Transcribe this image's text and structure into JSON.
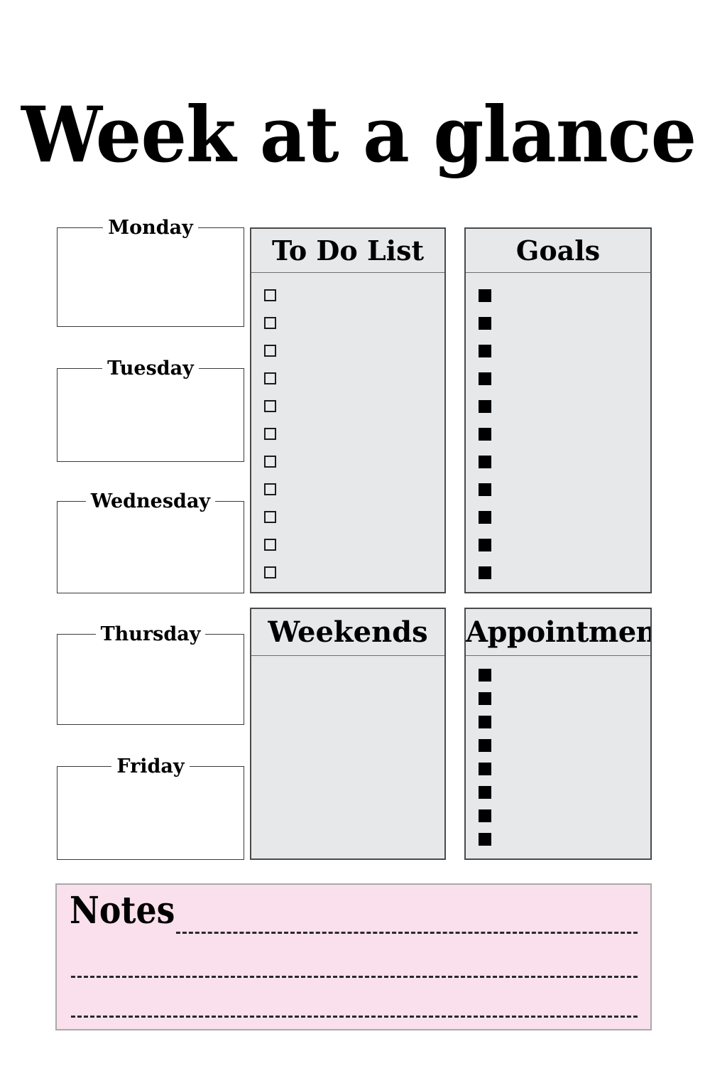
{
  "page": {
    "title": "Week at a glance",
    "background_color": "#ffffff",
    "panel_fill": "#e6e8ea",
    "panel_border": "#4a4a4a",
    "notes_fill": "#fae0ec",
    "notes_border": "#a9a9a9",
    "text_color": "#000000"
  },
  "days": [
    {
      "label": "Monday"
    },
    {
      "label": "Tuesday"
    },
    {
      "label": "Wednesday"
    },
    {
      "label": "Thursday"
    },
    {
      "label": "Friday"
    }
  ],
  "panels": {
    "todo": {
      "title": "To Do List",
      "marker": "checkbox",
      "item_count": 11
    },
    "goals": {
      "title": "Goals",
      "marker": "filled-square",
      "item_count": 11
    },
    "weekends": {
      "title": "Weekends",
      "marker": "none",
      "item_count": 0
    },
    "appointment": {
      "title": "Appointment",
      "marker": "filled-square",
      "item_count": 8
    }
  },
  "notes": {
    "title": "Notes",
    "line_count": 3,
    "line_style": "dashed"
  }
}
